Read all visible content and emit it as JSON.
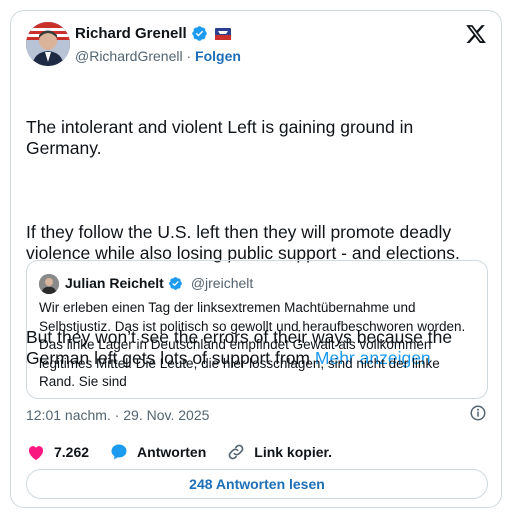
{
  "author": {
    "name": "Richard Grenell",
    "handle": "@RichardGrenell",
    "separator": "·",
    "follow_label": "Folgen"
  },
  "tweet": {
    "paragraphs": [
      "The intolerant and violent Left is gaining ground in Germany.",
      "If they follow the U.S. left then they will promote deadly violence while also losing public support - and elections.",
      "But they won’t see the errors of their ways because the German left gets lots of support from"
    ],
    "more_label": "Mehr anzeigen"
  },
  "quote": {
    "name": "Julian Reichelt",
    "handle": "@jreichelt",
    "text": "Wir erleben einen Tag der linksextremen Machtübernahme und Selbstjustiz. Das ist politisch so gewollt und heraufbeschworen worden. Das linke Lager in Deutschland empfindet Gewalt als vollkommen legitimes Mittel. Die Leute, die hier losschlagen, sind nicht der linke Rand. Sie sind"
  },
  "meta": {
    "timestamp": "12:01 nachm. · 29. Nov. 2025"
  },
  "actions": {
    "likes": "7.262",
    "reply_label": "Antworten",
    "copy_label": "Link kopier."
  },
  "replies_button": "248 Antworten lesen",
  "colors": {
    "accent": "#1d9bf0",
    "like": "#f91880",
    "text": "#0f1419",
    "muted": "#536471"
  },
  "icons": [
    "verified-icon",
    "affiliate-flag-icon",
    "x-logo-icon",
    "info-icon",
    "heart-icon",
    "reply-bubble-icon",
    "link-icon"
  ]
}
